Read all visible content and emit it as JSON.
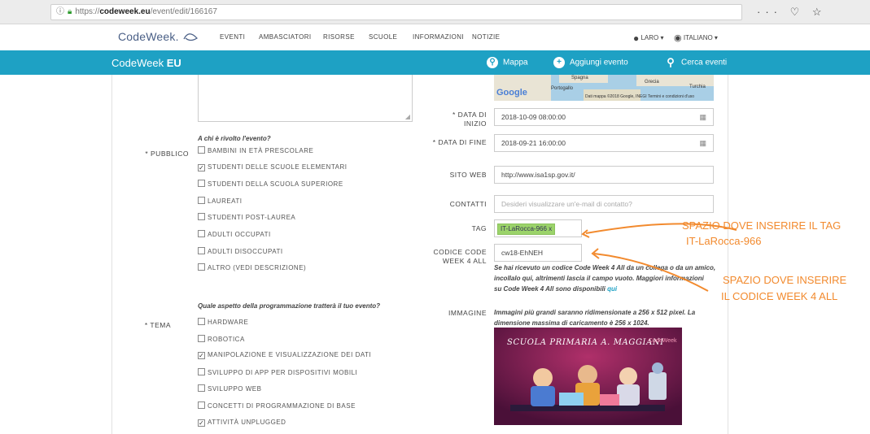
{
  "browser": {
    "url_prefix": "https://",
    "url_domain": "codeweek.eu",
    "url_path": "/event/edit/166167",
    "icons": [
      "info-icon",
      "lock-icon",
      "more-icon",
      "pocket-icon",
      "star-icon"
    ],
    "right_icons_text": "··· ♡ ☆"
  },
  "nav": {
    "logo_text": "CodeWeek.",
    "items": [
      "EVENTI",
      "AMBASCIATORI",
      "RISORSE",
      "SCUOLE",
      "INFORMAZIONI",
      "NOTIZIE"
    ],
    "user": "LARO ▾",
    "lang": "ITALIANO ▾"
  },
  "bar": {
    "brand_a": "CodeWeek",
    "brand_b": "EU",
    "map": "Mappa",
    "add": "Aggiungi evento",
    "search": "Cerca eventi"
  },
  "form": {
    "audience_question": "A chi è rivolto l'evento?",
    "audience_label": "* PUBBLICO",
    "audience": [
      {
        "label": "BAMBINI IN ETÀ PRESCOLARE",
        "checked": false
      },
      {
        "label": "STUDENTI DELLE SCUOLE ELEMENTARI",
        "checked": true
      },
      {
        "label": "STUDENTI DELLA SCUOLA SUPERIORE",
        "checked": false
      },
      {
        "label": "LAUREATI",
        "checked": false
      },
      {
        "label": "STUDENTI POST-LAUREA",
        "checked": false
      },
      {
        "label": "ADULTI OCCUPATI",
        "checked": false
      },
      {
        "label": "ADULTI DISOCCUPATI",
        "checked": false
      },
      {
        "label": "ALTRO (VEDI DESCRIZIONE)",
        "checked": false
      }
    ],
    "theme_question": "Quale aspetto della programmazione tratterà il tuo evento?",
    "theme_label": "* TEMA",
    "themes": [
      {
        "label": "HARDWARE",
        "checked": false
      },
      {
        "label": "ROBOTICA",
        "checked": false
      },
      {
        "label": "MANIPOLAZIONE E VISUALIZZAZIONE DEI DATI",
        "checked": true
      },
      {
        "label": "SVILUPPO DI APP PER DISPOSITIVI MOBILI",
        "checked": false
      },
      {
        "label": "SVILUPPO WEB",
        "checked": false
      },
      {
        "label": "CONCETTI DI PROGRAMMAZIONE DI BASE",
        "checked": false
      },
      {
        "label": "ATTIVITÀ UNPLUGGED",
        "checked": true
      }
    ],
    "start_label_1": "* DATA DI",
    "start_label_2": "INIZIO",
    "start_value": "2018-10-09 08:00:00",
    "end_label": "* DATA DI FINE",
    "end_value": "2018-09-21 16:00:00",
    "site_label": "SITO WEB",
    "site_value": "http://www.isa1sp.gov.it/",
    "contact_label": "CONTATTI",
    "contact_placeholder": "Desideri visualizzare un'e-mail di contatto?",
    "tag_label": "TAG",
    "tag_value": "IT-LaRocca-966 x",
    "code_label_1": "CODICE CODE",
    "code_label_2": "WEEK 4 ALL",
    "code_value": "cw18-EhNEH",
    "code_help_1": "Se hai ricevuto un codice Code Week 4 All da un collega o da un amico,",
    "code_help_2": "incollalo qui, altrimenti lascia il campo vuoto. Maggiori informazioni",
    "code_help_3": "su Code Week 4 All sono disponibili",
    "code_help_link": "qui",
    "image_label": "IMMAGINE",
    "image_help_1": "Immagini più grandi saranno ridimensionate a 256 x 512 pixel. La",
    "image_help_2": "dimensione massima di caricamento è 256 x 1024."
  },
  "map": {
    "google": "Google",
    "spagna": "Spagna",
    "portogallo": "Portogallo",
    "grecia": "Grecia",
    "turchia": "Turchia",
    "credits": "Dati mappa ©2018 Google, INEGI   Termini e condizioni d'uso"
  },
  "poster": {
    "title": "SCUOLA PRIMARIA A. MAGGIANI",
    "logo": "CodeWeek"
  },
  "annotations": {
    "tag_1": "SPAZIO DOVE INSERIRE IL TAG",
    "tag_2": "IT-LaRocca-966",
    "code_1": "SPAZIO DOVE INSERIRE",
    "code_2": "IL CODICE  WEEK 4 ALL",
    "color": "#f28a2e"
  }
}
